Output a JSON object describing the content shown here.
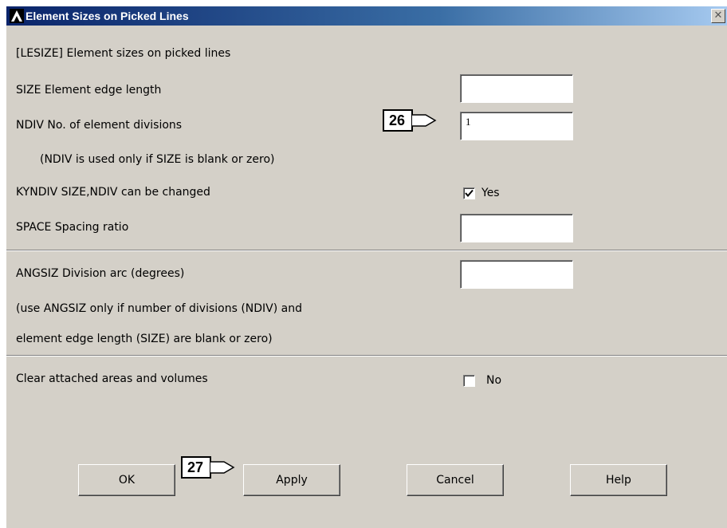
{
  "window": {
    "title": "Element Sizes on Picked Lines",
    "close_symbol": "✕"
  },
  "header_text": "[LESIZE]  Element sizes on picked lines",
  "rows": {
    "size": {
      "label": "SIZE   Element edge length",
      "value": ""
    },
    "ndiv": {
      "label": "NDIV   No. of element divisions",
      "value": "1"
    },
    "ndiv_note": "(NDIV is used only if SIZE is blank or zero)",
    "kyndiv": {
      "label": "KYNDIV  SIZE,NDIV can be changed",
      "checkbox_label": "Yes",
      "checked": true
    },
    "space": {
      "label": "SPACE   Spacing ratio",
      "value": ""
    },
    "angsiz": {
      "label": "ANGSIZ  Division arc (degrees)",
      "value": ""
    },
    "angsiz_note_1": "(use ANGSIZ only if number of divisions (NDIV) and",
    "angsiz_note_2": "element edge length (SIZE) are blank or zero)",
    "clear": {
      "label": "Clear attached areas and volumes",
      "checkbox_label": "No",
      "checked": false
    }
  },
  "buttons": {
    "ok": "OK",
    "apply": "Apply",
    "cancel": "Cancel",
    "help": "Help"
  },
  "callouts": {
    "step_26": "26",
    "step_27": "27"
  },
  "colors": {
    "titlebar": "#0a246a",
    "dialog_bg": "#d4d0c8"
  }
}
